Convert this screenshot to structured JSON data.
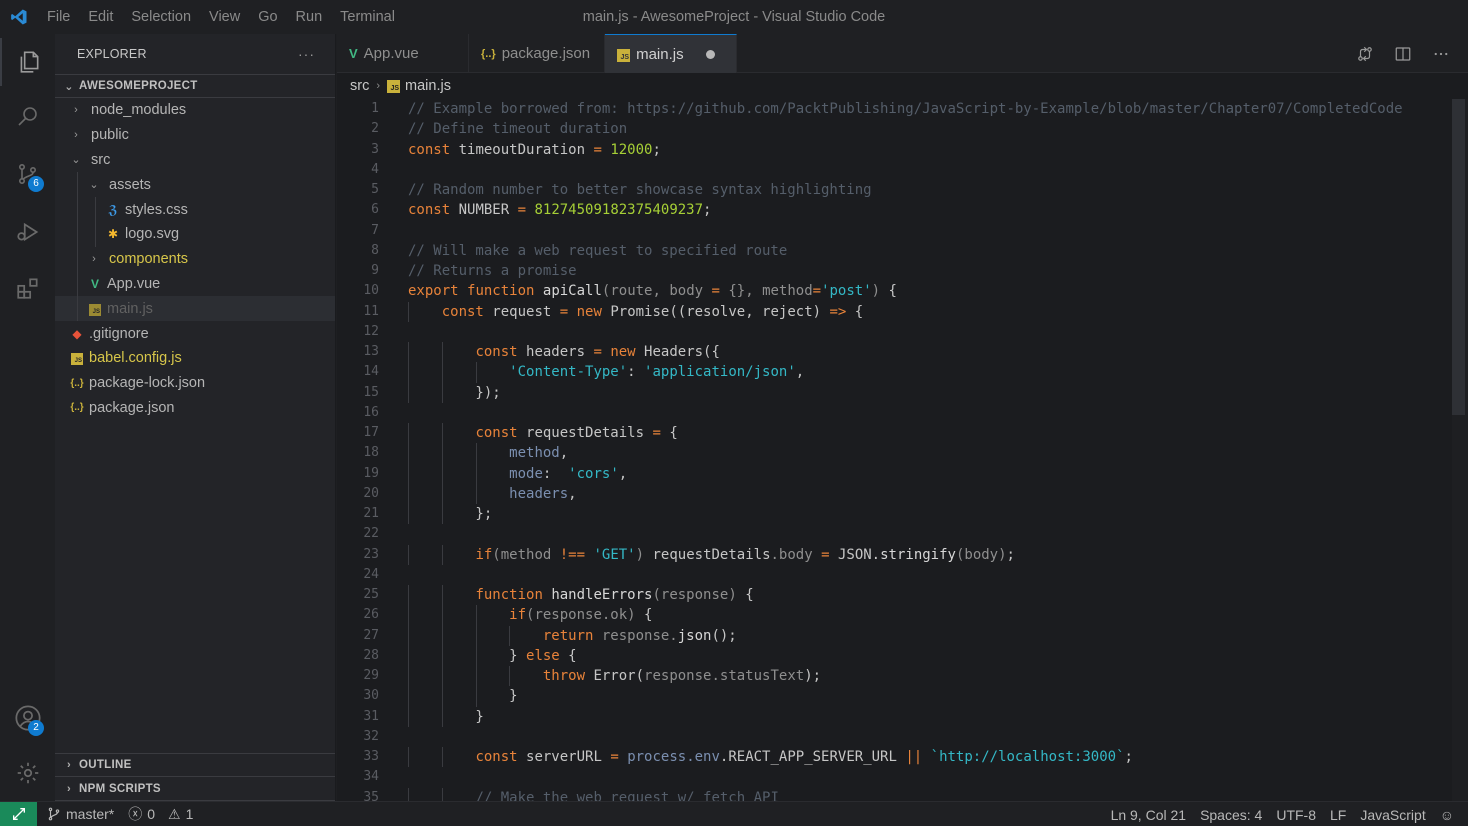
{
  "titlebar": {
    "menu": [
      "File",
      "Edit",
      "Selection",
      "View",
      "Go",
      "Run",
      "Terminal"
    ],
    "window_title": "main.js - AwesomeProject - Visual Studio Code"
  },
  "activity": {
    "scm_badge": "6",
    "accounts_badge": "2"
  },
  "sidebar": {
    "title": "EXPLORER",
    "more": "···",
    "project": "AWESOMEPROJECT",
    "tree": [
      {
        "label": "node_modules",
        "kind": "folder",
        "depth": 0,
        "expanded": false
      },
      {
        "label": "public",
        "kind": "folder",
        "depth": 0,
        "expanded": false
      },
      {
        "label": "src",
        "kind": "folder",
        "depth": 0,
        "expanded": true
      },
      {
        "label": "assets",
        "kind": "folder",
        "depth": 1,
        "expanded": true
      },
      {
        "label": "styles.css",
        "kind": "css",
        "depth": 2
      },
      {
        "label": "logo.svg",
        "kind": "svg",
        "depth": 2
      },
      {
        "label": "components",
        "kind": "folder",
        "depth": 1,
        "expanded": false,
        "highlight": true
      },
      {
        "label": "App.vue",
        "kind": "vue",
        "depth": 1
      },
      {
        "label": "main.js",
        "kind": "js",
        "depth": 1,
        "selected": true
      },
      {
        "label": ".gitignore",
        "kind": "git",
        "depth": 0
      },
      {
        "label": "babel.config.js",
        "kind": "js",
        "depth": 0,
        "highlight": true
      },
      {
        "label": "package-lock.json",
        "kind": "json",
        "depth": 0
      },
      {
        "label": "package.json",
        "kind": "json",
        "depth": 0
      }
    ],
    "outline": "OUTLINE",
    "npm_scripts": "NPM SCRIPTS"
  },
  "tabs": [
    {
      "label": "App.vue",
      "icon": "V",
      "icon_color": "#41b883",
      "active": false
    },
    {
      "label": "package.json",
      "icon": "{..}",
      "icon_color": "#c9b13b",
      "active": false
    },
    {
      "label": "main.js",
      "icon": "JS",
      "icon_color": "#c9b13b",
      "active": true,
      "dirty": true
    }
  ],
  "breadcrumb": {
    "folder": "src",
    "file": "main.js"
  },
  "code": [
    [
      [
        "c-comment",
        "// Example borrowed from: https://github.com/PacktPublishing/JavaScript-by-Example/blob/master/Chapter07/CompletedCode"
      ]
    ],
    [
      [
        "c-comment",
        "// Define timeout duration"
      ]
    ],
    [
      [
        "c-kw",
        "const"
      ],
      [
        "c-ident",
        " timeoutDuration "
      ],
      [
        "c-op",
        "="
      ],
      [
        "c-ident",
        " "
      ],
      [
        "c-num",
        "12000"
      ],
      [
        "c-ident",
        ";"
      ]
    ],
    [],
    [
      [
        "c-comment",
        "// Random number to better showcase syntax highlighting"
      ]
    ],
    [
      [
        "c-kw",
        "const"
      ],
      [
        "c-ident",
        " NUMBER "
      ],
      [
        "c-op",
        "="
      ],
      [
        "c-ident",
        " "
      ],
      [
        "c-num",
        "81274509182375409237"
      ],
      [
        "c-ident",
        ";"
      ]
    ],
    [],
    [
      [
        "c-comment",
        "// Will make a web request to specified route"
      ]
    ],
    [
      [
        "c-comment",
        "// Returns a promise"
      ]
    ],
    [
      [
        "c-kw",
        "export"
      ],
      [
        "c-ident",
        " "
      ],
      [
        "c-kw",
        "function"
      ],
      [
        "c-ident",
        " "
      ],
      [
        "c-fn",
        "apiCall"
      ],
      [
        "c-param",
        "(route, body "
      ],
      [
        "c-op",
        "="
      ],
      [
        "c-param",
        " {}, method"
      ],
      [
        "c-op",
        "="
      ],
      [
        "c-str",
        "'post'"
      ],
      [
        "c-param",
        ")"
      ],
      [
        "c-ident",
        " {"
      ]
    ],
    [
      [
        "c-ident",
        "    "
      ],
      [
        "c-kw",
        "const"
      ],
      [
        "c-ident",
        " request "
      ],
      [
        "c-op",
        "="
      ],
      [
        "c-ident",
        " "
      ],
      [
        "c-kw",
        "new"
      ],
      [
        "c-ident",
        " Promise((resolve, reject) "
      ],
      [
        "c-op",
        "=>"
      ],
      [
        "c-ident",
        " {"
      ]
    ],
    [],
    [
      [
        "c-ident",
        "        "
      ],
      [
        "c-kw",
        "const"
      ],
      [
        "c-ident",
        " headers "
      ],
      [
        "c-op",
        "="
      ],
      [
        "c-ident",
        " "
      ],
      [
        "c-kw",
        "new"
      ],
      [
        "c-ident",
        " Headers({"
      ]
    ],
    [
      [
        "c-ident",
        "            "
      ],
      [
        "c-str",
        "'Content-Type'"
      ],
      [
        "c-ident",
        ": "
      ],
      [
        "c-str",
        "'application/json'"
      ],
      [
        "c-ident",
        ","
      ]
    ],
    [
      [
        "c-ident",
        "        });"
      ]
    ],
    [],
    [
      [
        "c-ident",
        "        "
      ],
      [
        "c-kw",
        "const"
      ],
      [
        "c-ident",
        " requestDetails "
      ],
      [
        "c-op",
        "="
      ],
      [
        "c-ident",
        " {"
      ]
    ],
    [
      [
        "c-ident",
        "            "
      ],
      [
        "c-prop",
        "method"
      ],
      [
        "c-ident",
        ","
      ]
    ],
    [
      [
        "c-ident",
        "            "
      ],
      [
        "c-prop",
        "mode"
      ],
      [
        "c-ident",
        ":  "
      ],
      [
        "c-str",
        "'cors'"
      ],
      [
        "c-ident",
        ","
      ]
    ],
    [
      [
        "c-ident",
        "            "
      ],
      [
        "c-prop",
        "headers"
      ],
      [
        "c-ident",
        ","
      ]
    ],
    [
      [
        "c-ident",
        "        };"
      ]
    ],
    [],
    [
      [
        "c-ident",
        "        "
      ],
      [
        "c-kw",
        "if"
      ],
      [
        "c-param",
        "(method "
      ],
      [
        "c-op",
        "!=="
      ],
      [
        "c-ident",
        " "
      ],
      [
        "c-str",
        "'GET'"
      ],
      [
        "c-param",
        ")"
      ],
      [
        "c-ident",
        " requestDetails"
      ],
      [
        "c-param",
        ".body"
      ],
      [
        "c-ident",
        " "
      ],
      [
        "c-op",
        "="
      ],
      [
        "c-ident",
        " JSON."
      ],
      [
        "c-fn",
        "stringify"
      ],
      [
        "c-param",
        "(body)"
      ],
      [
        "c-ident",
        ";"
      ]
    ],
    [],
    [
      [
        "c-ident",
        "        "
      ],
      [
        "c-kw",
        "function"
      ],
      [
        "c-ident",
        " "
      ],
      [
        "c-fn",
        "handleErrors"
      ],
      [
        "c-param",
        "(response)"
      ],
      [
        "c-ident",
        " {"
      ]
    ],
    [
      [
        "c-ident",
        "            "
      ],
      [
        "c-kw",
        "if"
      ],
      [
        "c-param",
        "(response.ok)"
      ],
      [
        "c-ident",
        " {"
      ]
    ],
    [
      [
        "c-ident",
        "                "
      ],
      [
        "c-kw",
        "return"
      ],
      [
        "c-ident",
        " "
      ],
      [
        "c-param",
        "response."
      ],
      [
        "c-fn",
        "json"
      ],
      [
        "c-ident",
        "();"
      ]
    ],
    [
      [
        "c-ident",
        "            } "
      ],
      [
        "c-kw",
        "else"
      ],
      [
        "c-ident",
        " {"
      ]
    ],
    [
      [
        "c-ident",
        "                "
      ],
      [
        "c-kw",
        "throw"
      ],
      [
        "c-ident",
        " Error("
      ],
      [
        "c-param",
        "response.statusText"
      ],
      [
        "c-ident",
        ");"
      ]
    ],
    [
      [
        "c-ident",
        "            }"
      ]
    ],
    [
      [
        "c-ident",
        "        }"
      ]
    ],
    [],
    [
      [
        "c-ident",
        "        "
      ],
      [
        "c-kw",
        "const"
      ],
      [
        "c-ident",
        " serverURL "
      ],
      [
        "c-op",
        "="
      ],
      [
        "c-ident",
        " "
      ],
      [
        "c-prop",
        "process.env"
      ],
      [
        "c-ident",
        ".REACT_APP_SERVER_URL "
      ],
      [
        "c-op",
        "||"
      ],
      [
        "c-ident",
        " "
      ],
      [
        "c-str",
        "`http://localhost:3000`"
      ],
      [
        "c-ident",
        ";"
      ]
    ],
    [],
    [
      [
        "c-ident",
        "        "
      ],
      [
        "c-comment",
        "// Make the web request w/ fetch API"
      ]
    ]
  ],
  "status": {
    "branch": "master*",
    "errors": "0",
    "warnings": "1",
    "position": "Ln 9, Col 21",
    "spaces": "Spaces: 4",
    "encoding": "UTF-8",
    "eol": "LF",
    "language": "JavaScript"
  }
}
